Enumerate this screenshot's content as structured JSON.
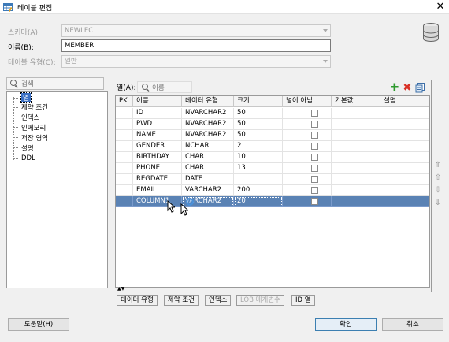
{
  "window": {
    "title": "테이블 편집",
    "close_glyph": "✕"
  },
  "form": {
    "schema_label": "스키마(A):",
    "schema_value": "NEWLEC",
    "name_label": "이름(B):",
    "name_value": "MEMBER",
    "table_type_label": "테이블 유형(C):",
    "table_type_value": "일반"
  },
  "left_panel": {
    "search_placeholder": "검색",
    "tree_items": [
      "열",
      "제약 조건",
      "인덱스",
      "인메모리",
      "저장 영역",
      "설명",
      "DDL"
    ],
    "selected_index": 0
  },
  "columns_panel": {
    "filter_label": "열(A):",
    "filter_placeholder": "이름",
    "toolbar": {
      "add_icon": "plus-icon",
      "remove_icon": "delete-icon",
      "copy_icon": "copy-icon"
    },
    "headers": [
      "PK",
      "이름",
      "데이터 유형",
      "크기",
      "널이 아님",
      "기본값",
      "설명"
    ],
    "rows": [
      {
        "pk": "",
        "name": "ID",
        "type": "NVARCHAR2",
        "size": "50",
        "not_null": false
      },
      {
        "pk": "",
        "name": "PWD",
        "type": "NVARCHAR2",
        "size": "50",
        "not_null": false
      },
      {
        "pk": "",
        "name": "NAME",
        "type": "NVARCHAR2",
        "size": "50",
        "not_null": false
      },
      {
        "pk": "",
        "name": "GENDER",
        "type": "NCHAR",
        "size": "2",
        "not_null": false
      },
      {
        "pk": "",
        "name": "BIRTHDAY",
        "type": "CHAR",
        "size": "10",
        "not_null": false
      },
      {
        "pk": "",
        "name": "PHONE",
        "type": "CHAR",
        "size": "13",
        "not_null": false
      },
      {
        "pk": "",
        "name": "REGDATE",
        "type": "DATE",
        "size": "",
        "not_null": false
      },
      {
        "pk": "",
        "name": "EMAIL",
        "type": "VARCHAR2",
        "size": "200",
        "not_null": false
      },
      {
        "pk": "",
        "name": "COLUMN1",
        "type": "VARCHAR2",
        "size": "20",
        "not_null": false
      }
    ],
    "selected_row": 8
  },
  "bottom_tabs": [
    "데이터 유형",
    "제약 조건",
    "인덱스",
    "LOB 매개변수",
    "ID 열"
  ],
  "buttons": {
    "help": "도움말(H)",
    "ok": "확인",
    "cancel": "취소"
  },
  "colors": {
    "selection": "#5a82b4",
    "tree_selection": "#3a6fc4",
    "add_icon": "#2e9a2e",
    "remove_icon": "#d93025"
  }
}
